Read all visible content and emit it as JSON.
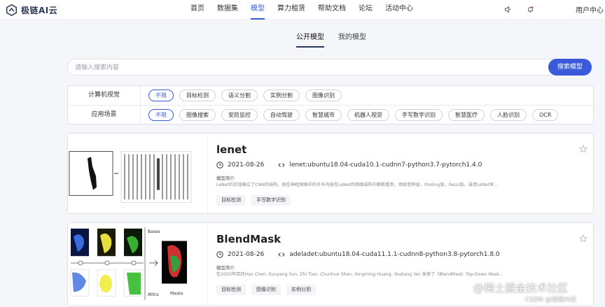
{
  "header": {
    "logo_text": "极链AI云",
    "nav": [
      {
        "label": "首页"
      },
      {
        "label": "数据集"
      },
      {
        "label": "模型"
      },
      {
        "label": "算力租赁"
      },
      {
        "label": "帮助文档"
      },
      {
        "label": "论坛"
      },
      {
        "label": "活动中心"
      }
    ],
    "active_nav": "模型",
    "icons": [
      "speaker-icon",
      "bell-icon"
    ],
    "user_center": "用户中心"
  },
  "subtabs": [
    {
      "label": "公开模型",
      "active": true
    },
    {
      "label": "我的模型",
      "active": false
    }
  ],
  "search": {
    "placeholder": "请输入搜索内容",
    "value": "",
    "button": "搜索模型"
  },
  "filters": [
    {
      "label": "计算机视觉",
      "chips": [
        "不限",
        "目标检测",
        "语义分割",
        "实例分割",
        "图像识别"
      ],
      "selected": "不限"
    },
    {
      "label": "应用场景",
      "chips": [
        "不限",
        "图像搜索",
        "安防监控",
        "自动驾驶",
        "智慧城市",
        "机器人视觉",
        "手写数字识别",
        "智慧医疗",
        "人脸识别",
        "OCR"
      ],
      "selected": "不限"
    }
  ],
  "models": [
    {
      "title": "lenet",
      "date": "2021-08-26",
      "image_tag": "lenet:ubuntu18.04-cuda10.1-cudnn7-python3.7-pytorch1.4.0",
      "intro_label": "模型简介",
      "intro": "LeNet的实现确立了CNN的结构，现在神经网络中的许多内容在LeNet的网络结构中都能看到，例如卷积层，Pooling层，ReLU层。虽然LeNet早...",
      "tags": [
        "目标检测",
        "手写数字识别"
      ]
    },
    {
      "title": "BlendMask",
      "date": "2021-08-26",
      "image_tag": "adeladet:ubuntu18.04-cuda11.1.1-cudnn8-python3.8-pytorch1.8.0",
      "intro_label": "模型简介",
      "intro": "在2020年四月Hao Chen, Kunyang Sun, Zhi Tian, Chunhua Shen, Yongming Huang, Youliang Yan 发表了《BlendMask: Top-Down Meet...",
      "tags": [
        "目标检测",
        "图像识别",
        "实例分割"
      ],
      "thumb_labels": {
        "bases": "Bases",
        "attns": "Attns",
        "masks": "Masks"
      }
    }
  ],
  "watermark": {
    "line1": "@稀土掘金技术社区",
    "line2": "CSDN @极链AI云"
  },
  "colors": {
    "accent": "#3a5bd9",
    "dark": "#2b3a55"
  }
}
